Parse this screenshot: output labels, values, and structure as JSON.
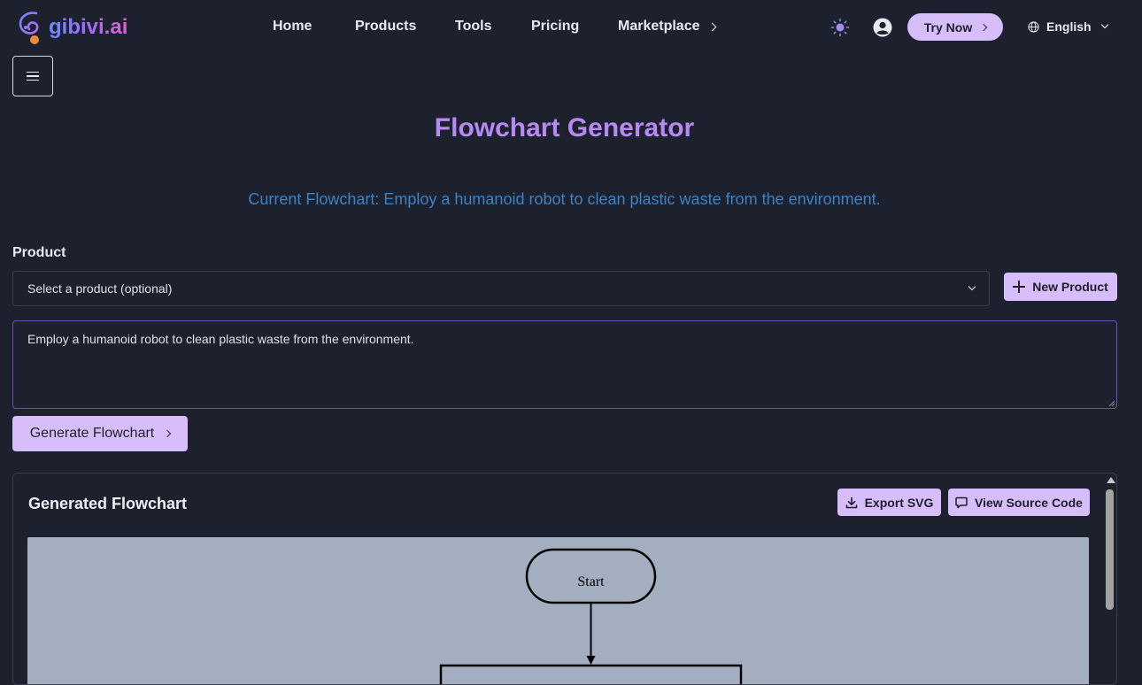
{
  "brand": {
    "name": "gibivi.ai"
  },
  "nav": {
    "links": [
      "Home",
      "Products",
      "Tools",
      "Pricing",
      "Marketplace"
    ],
    "try_now": "Try Now",
    "language": "English"
  },
  "page": {
    "title": "Flowchart Generator",
    "current": "Current Flowchart: Employ a humanoid robot to clean plastic waste from the environment."
  },
  "form": {
    "product_label": "Product",
    "product_select": "Select a product (optional)",
    "new_product": "New Product",
    "prompt_value": "Employ a humanoid robot to clean plastic waste from the environment.",
    "generate": "Generate Flowchart"
  },
  "result": {
    "title": "Generated Flowchart",
    "export": "Export SVG",
    "view_source": "View Source Code",
    "start_node": "Start"
  },
  "colors": {
    "background": "#1d212d",
    "accent": "#d8bdfb",
    "title": "#b68af2",
    "subtitle": "#3b82c6",
    "canvas": "#a3afc0"
  }
}
